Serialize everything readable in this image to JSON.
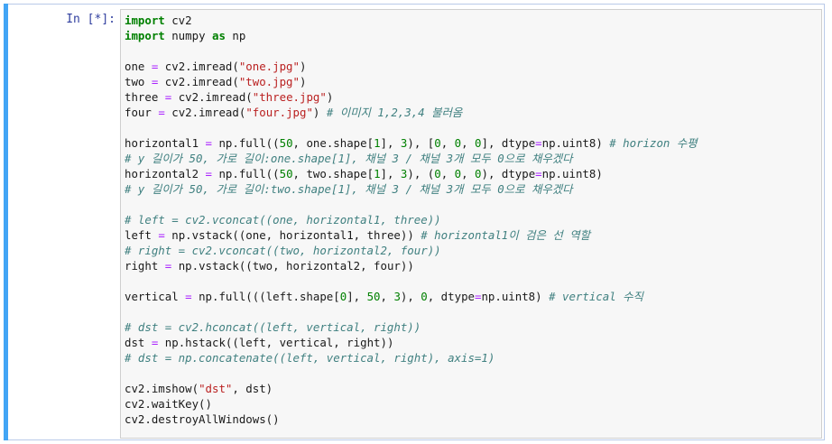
{
  "cell": {
    "prompt": "In [*]:",
    "lines": [
      [
        {
          "t": "import",
          "c": "kw"
        },
        {
          "t": " cv2",
          "c": ""
        }
      ],
      [
        {
          "t": "import",
          "c": "kw"
        },
        {
          "t": " numpy ",
          "c": ""
        },
        {
          "t": "as",
          "c": "kw"
        },
        {
          "t": " np",
          "c": ""
        }
      ],
      [],
      [
        {
          "t": "one ",
          "c": ""
        },
        {
          "t": "=",
          "c": "op"
        },
        {
          "t": " cv2.imread(",
          "c": ""
        },
        {
          "t": "\"one.jpg\"",
          "c": "str"
        },
        {
          "t": ")",
          "c": ""
        }
      ],
      [
        {
          "t": "two ",
          "c": ""
        },
        {
          "t": "=",
          "c": "op"
        },
        {
          "t": " cv2.imread(",
          "c": ""
        },
        {
          "t": "\"two.jpg\"",
          "c": "str"
        },
        {
          "t": ")",
          "c": ""
        }
      ],
      [
        {
          "t": "three ",
          "c": ""
        },
        {
          "t": "=",
          "c": "op"
        },
        {
          "t": " cv2.imread(",
          "c": ""
        },
        {
          "t": "\"three.jpg\"",
          "c": "str"
        },
        {
          "t": ")",
          "c": ""
        }
      ],
      [
        {
          "t": "four ",
          "c": ""
        },
        {
          "t": "=",
          "c": "op"
        },
        {
          "t": " cv2.imread(",
          "c": ""
        },
        {
          "t": "\"four.jpg\"",
          "c": "str"
        },
        {
          "t": ") ",
          "c": ""
        },
        {
          "t": "# 이미지 1,2,3,4 불러옴",
          "c": "cm"
        }
      ],
      [],
      [
        {
          "t": "horizontal1 ",
          "c": ""
        },
        {
          "t": "=",
          "c": "op"
        },
        {
          "t": " np.full((",
          "c": ""
        },
        {
          "t": "50",
          "c": "num"
        },
        {
          "t": ", one.shape[",
          "c": ""
        },
        {
          "t": "1",
          "c": "num"
        },
        {
          "t": "], ",
          "c": ""
        },
        {
          "t": "3",
          "c": "num"
        },
        {
          "t": "), [",
          "c": ""
        },
        {
          "t": "0",
          "c": "num"
        },
        {
          "t": ", ",
          "c": ""
        },
        {
          "t": "0",
          "c": "num"
        },
        {
          "t": ", ",
          "c": ""
        },
        {
          "t": "0",
          "c": "num"
        },
        {
          "t": "], dtype",
          "c": ""
        },
        {
          "t": "=",
          "c": "op"
        },
        {
          "t": "np.uint8) ",
          "c": ""
        },
        {
          "t": "# horizon 수평",
          "c": "cm"
        }
      ],
      [
        {
          "t": "# y 길이가 50, 가로 길이:one.shape[1], 채널 3 / 채널 3개 모두 0으로 채우겠다",
          "c": "cm"
        }
      ],
      [
        {
          "t": "horizontal2 ",
          "c": ""
        },
        {
          "t": "=",
          "c": "op"
        },
        {
          "t": " np.full((",
          "c": ""
        },
        {
          "t": "50",
          "c": "num"
        },
        {
          "t": ", two.shape[",
          "c": ""
        },
        {
          "t": "1",
          "c": "num"
        },
        {
          "t": "], ",
          "c": ""
        },
        {
          "t": "3",
          "c": "num"
        },
        {
          "t": "), (",
          "c": ""
        },
        {
          "t": "0",
          "c": "num"
        },
        {
          "t": ", ",
          "c": ""
        },
        {
          "t": "0",
          "c": "num"
        },
        {
          "t": ", ",
          "c": ""
        },
        {
          "t": "0",
          "c": "num"
        },
        {
          "t": "), dtype",
          "c": ""
        },
        {
          "t": "=",
          "c": "op"
        },
        {
          "t": "np.uint8)",
          "c": ""
        }
      ],
      [
        {
          "t": "# y 길이가 50, 가로 길이:two.shape[1], 채널 3 / 채널 3개 모두 0으로 채우겠다",
          "c": "cm"
        }
      ],
      [],
      [
        {
          "t": "# left = cv2.vconcat((one, horizontal1, three))",
          "c": "cm"
        }
      ],
      [
        {
          "t": "left ",
          "c": ""
        },
        {
          "t": "=",
          "c": "op"
        },
        {
          "t": " np.vstack((one, horizontal1, three)) ",
          "c": ""
        },
        {
          "t": "# horizontal1이 검은 선 역할",
          "c": "cm"
        }
      ],
      [
        {
          "t": "# right = cv2.vconcat((two, horizontal2, four))",
          "c": "cm"
        }
      ],
      [
        {
          "t": "right ",
          "c": ""
        },
        {
          "t": "=",
          "c": "op"
        },
        {
          "t": " np.vstack((two, horizontal2, four))",
          "c": ""
        }
      ],
      [],
      [
        {
          "t": "vertical ",
          "c": ""
        },
        {
          "t": "=",
          "c": "op"
        },
        {
          "t": " np.full(((left.shape[",
          "c": ""
        },
        {
          "t": "0",
          "c": "num"
        },
        {
          "t": "], ",
          "c": ""
        },
        {
          "t": "50",
          "c": "num"
        },
        {
          "t": ", ",
          "c": ""
        },
        {
          "t": "3",
          "c": "num"
        },
        {
          "t": "), ",
          "c": ""
        },
        {
          "t": "0",
          "c": "num"
        },
        {
          "t": ", dtype",
          "c": ""
        },
        {
          "t": "=",
          "c": "op"
        },
        {
          "t": "np.uint8) ",
          "c": ""
        },
        {
          "t": "# vertical 수직",
          "c": "cm"
        }
      ],
      [],
      [
        {
          "t": "# dst = cv2.hconcat((left, vertical, right))",
          "c": "cm"
        }
      ],
      [
        {
          "t": "dst ",
          "c": ""
        },
        {
          "t": "=",
          "c": "op"
        },
        {
          "t": " np.hstack((left, vertical, right))",
          "c": ""
        }
      ],
      [
        {
          "t": "# dst = np.concatenate((left, vertical, right), axis=1)",
          "c": "cm"
        }
      ],
      [],
      [
        {
          "t": "cv2.imshow(",
          "c": ""
        },
        {
          "t": "\"dst\"",
          "c": "str"
        },
        {
          "t": ", dst)",
          "c": ""
        }
      ],
      [
        {
          "t": "cv2.waitKey()",
          "c": ""
        }
      ],
      [
        {
          "t": "cv2.destroyAllWindows()",
          "c": ""
        }
      ]
    ]
  }
}
